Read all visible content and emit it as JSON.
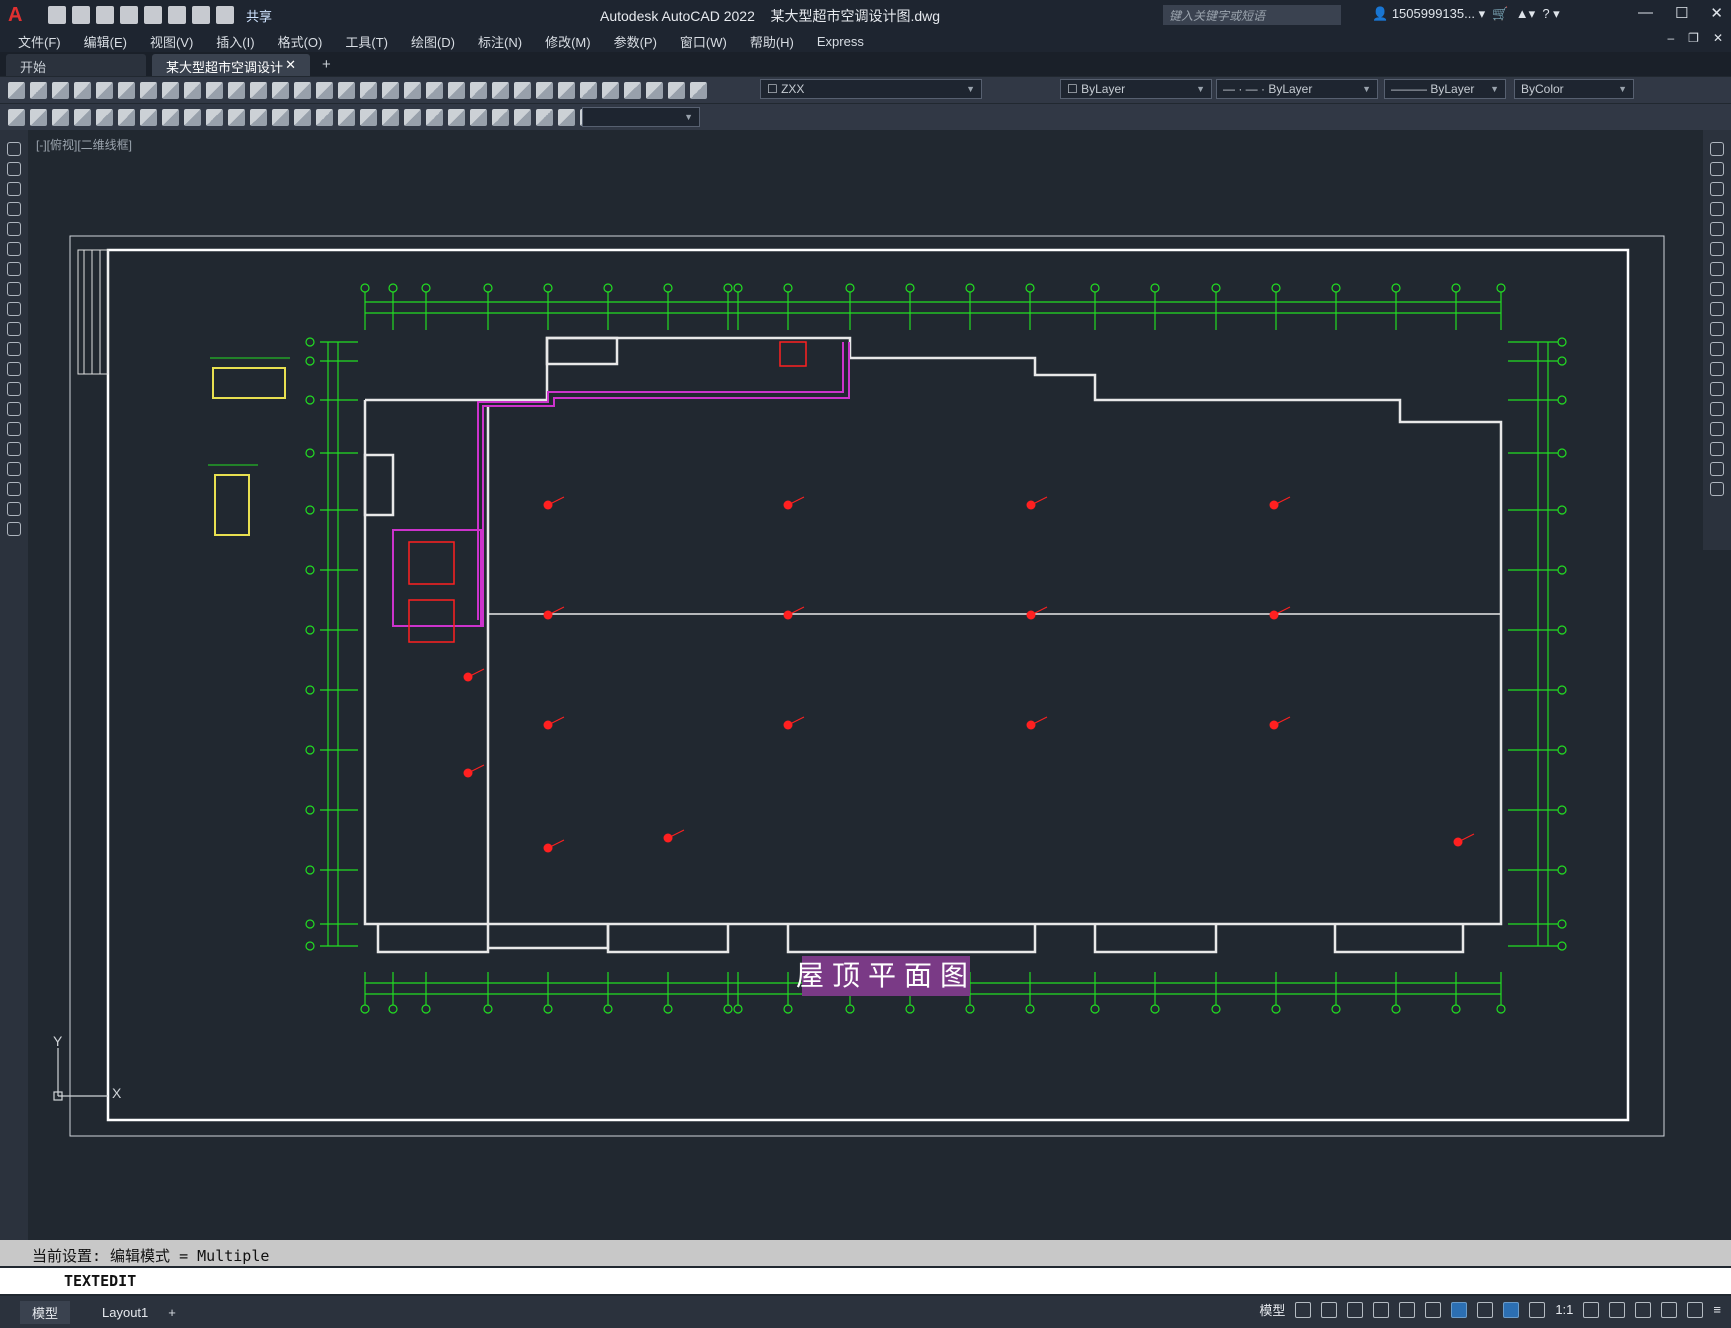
{
  "app": {
    "title": "Autodesk AutoCAD 2022",
    "filename": "某大型超市空调设计图.dwg",
    "share_label": "共享",
    "search_placeholder": "键入关键字或短语",
    "user": "1505999135...",
    "window_min": "—",
    "window_max": "☐",
    "window_close": "✕"
  },
  "menu": [
    "文件(F)",
    "编辑(E)",
    "视图(V)",
    "插入(I)",
    "格式(O)",
    "工具(T)",
    "绘图(D)",
    "标注(N)",
    "修改(M)",
    "参数(P)",
    "窗口(W)",
    "帮助(H)",
    "Express"
  ],
  "tabs": [
    {
      "label": "开始",
      "active": false
    },
    {
      "label": "某大型超市空调设计图*",
      "active": true
    }
  ],
  "layer": {
    "name": "ZXX"
  },
  "properties": {
    "color": "ByLayer",
    "linetype": "ByLayer",
    "lineweight": "ByLayer",
    "plotstyle": "ByColor"
  },
  "viewport": {
    "label": "[-][俯视][二维线框]",
    "drawing_title": "屋顶平面图",
    "ucs_x": "X",
    "ucs_y": "Y"
  },
  "command": {
    "history": "当前设置: 编辑模式 = Multiple",
    "current": "TEXTEDIT"
  },
  "status": {
    "layout_tabs": [
      "模型",
      "Layout1"
    ],
    "model_label": "模型",
    "scale": "1:1"
  },
  "colors": {
    "grid_green": "#22dd22",
    "red_equipment": "#ff2020",
    "magenta_duct": "#cc33cc",
    "title_bg": "#7a3a86"
  }
}
